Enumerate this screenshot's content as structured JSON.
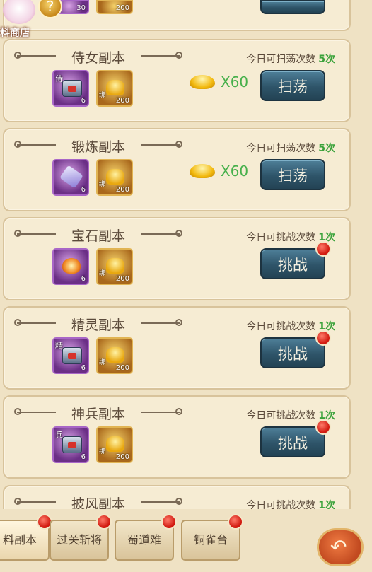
{
  "shop": {
    "label": "料商店",
    "help": "?"
  },
  "dungeons": [
    {
      "title": "侍女副本",
      "count_label": "今日可扫荡次数",
      "count": "5次",
      "item1_tag": "侍",
      "item1_qty": "6",
      "item2_tag": "绑",
      "item2_qty": "200",
      "cost": "X60",
      "action": "扫荡",
      "badge": false
    },
    {
      "title": "锻炼副本",
      "count_label": "今日可扫荡次数",
      "count": "5次",
      "item1_tag": "",
      "item1_qty": "6",
      "item2_tag": "绑",
      "item2_qty": "200",
      "cost": "X60",
      "action": "扫荡",
      "badge": false
    },
    {
      "title": "宝石副本",
      "count_label": "今日可挑战次数",
      "count": "1次",
      "item1_tag": "",
      "item1_qty": "6",
      "item2_tag": "绑",
      "item2_qty": "200",
      "cost": "",
      "action": "挑战",
      "badge": true
    },
    {
      "title": "精灵副本",
      "count_label": "今日可挑战次数",
      "count": "1次",
      "item1_tag": "精",
      "item1_qty": "6",
      "item2_tag": "绑",
      "item2_qty": "200",
      "cost": "",
      "action": "挑战",
      "badge": true
    },
    {
      "title": "神兵副本",
      "count_label": "今日可挑战次数",
      "count": "1次",
      "item1_tag": "兵",
      "item1_qty": "6",
      "item2_tag": "绑",
      "item2_qty": "200",
      "cost": "",
      "action": "挑战",
      "badge": true
    },
    {
      "title": "披风副本",
      "count_label": "今日可挑战次数",
      "count": "1次"
    }
  ],
  "top_partial": {
    "qty1": "30",
    "qty2": "200"
  },
  "tabs": [
    {
      "label": "料副本"
    },
    {
      "label": "过关斩将"
    },
    {
      "label": "蜀道难"
    },
    {
      "label": "铜雀台"
    }
  ],
  "back_icon": "return-arrow-icon"
}
